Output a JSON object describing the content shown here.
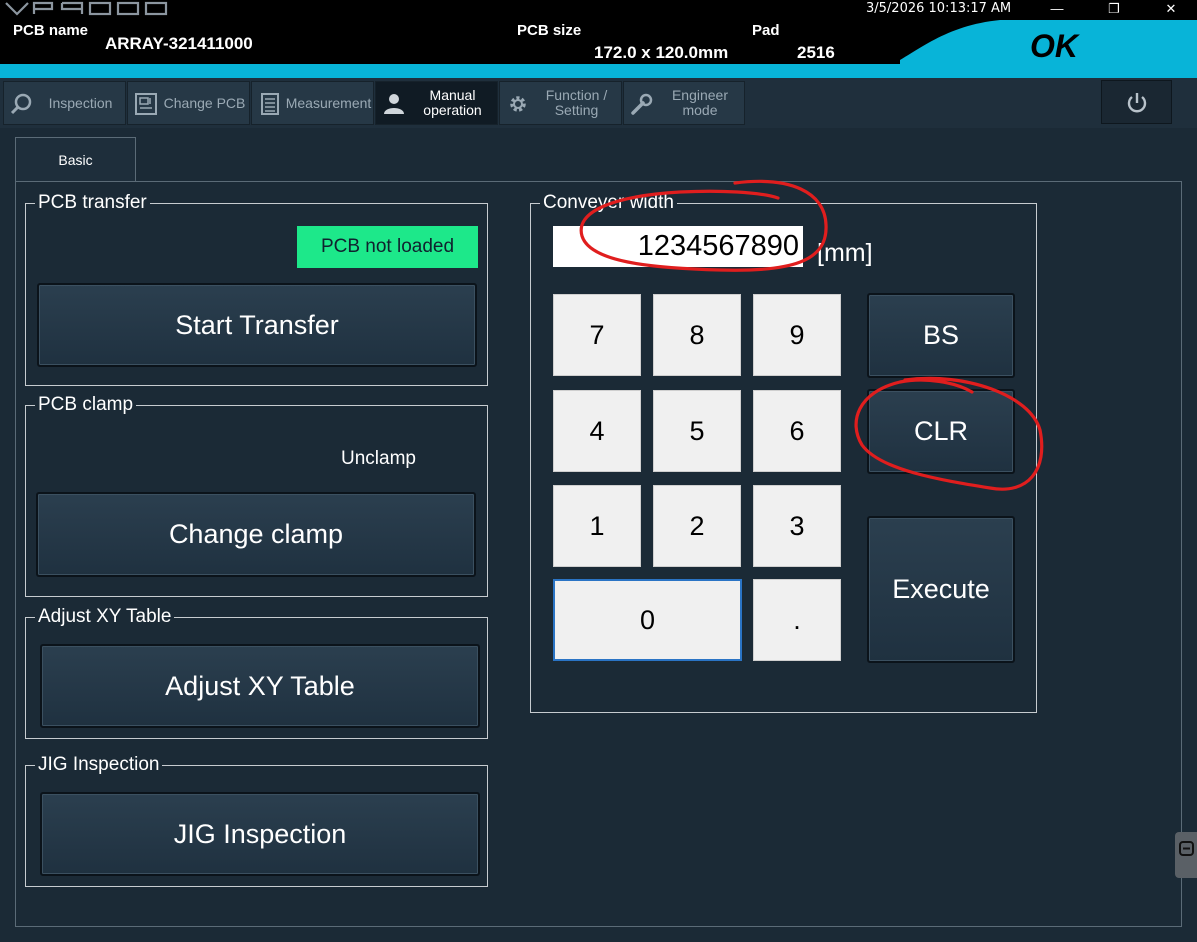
{
  "app": {
    "brand": "VP9000",
    "datetime": "3/5/2026 10:13:17 AM",
    "window_controls": [
      "minimize-icon",
      "restore-icon",
      "close-icon"
    ]
  },
  "header": {
    "pcb_name_label": "PCB name",
    "pcb_name_value": "ARRAY-321411000",
    "pcb_size_label": "PCB size",
    "pcb_size_value": "172.0 x 120.0mm",
    "pad_label": "Pad",
    "pad_value": "2516",
    "status": "OK",
    "accent_color": "#08b4d8"
  },
  "nav": {
    "items": [
      {
        "label": "Inspection",
        "icon": "magnifier-icon"
      },
      {
        "label": "Change PCB",
        "icon": "pcb-icon"
      },
      {
        "label": "Measurement",
        "icon": "document-list-icon"
      },
      {
        "label": "Manual operation",
        "icon": "person-icon",
        "active": true
      },
      {
        "label": "Function / Setting",
        "icon": "gear-icon"
      },
      {
        "label": "Engineer mode",
        "icon": "wrench-icon"
      }
    ],
    "power_icon": "power-icon"
  },
  "tabs": {
    "basic": "Basic"
  },
  "pcb_transfer": {
    "title": "PCB transfer",
    "status": "PCB not loaded",
    "status_color": "#1de88a",
    "button": "Start Transfer"
  },
  "pcb_clamp": {
    "title": "PCB clamp",
    "status": "Unclamp",
    "button": "Change clamp"
  },
  "adjust_xy": {
    "title": "Adjust XY Table",
    "button": "Adjust XY Table"
  },
  "jig": {
    "title": "JIG Inspection",
    "button": "JIG Inspection"
  },
  "conveyer": {
    "title": "Conveyer width",
    "value": "1234567890",
    "unit": "[mm]",
    "keys": {
      "k7": "7",
      "k8": "8",
      "k9": "9",
      "k4": "4",
      "k5": "5",
      "k6": "6",
      "k1": "1",
      "k2": "2",
      "k3": "3",
      "k0": "0",
      "kdot": "."
    },
    "bs": "BS",
    "clr": "CLR",
    "execute": "Execute"
  }
}
